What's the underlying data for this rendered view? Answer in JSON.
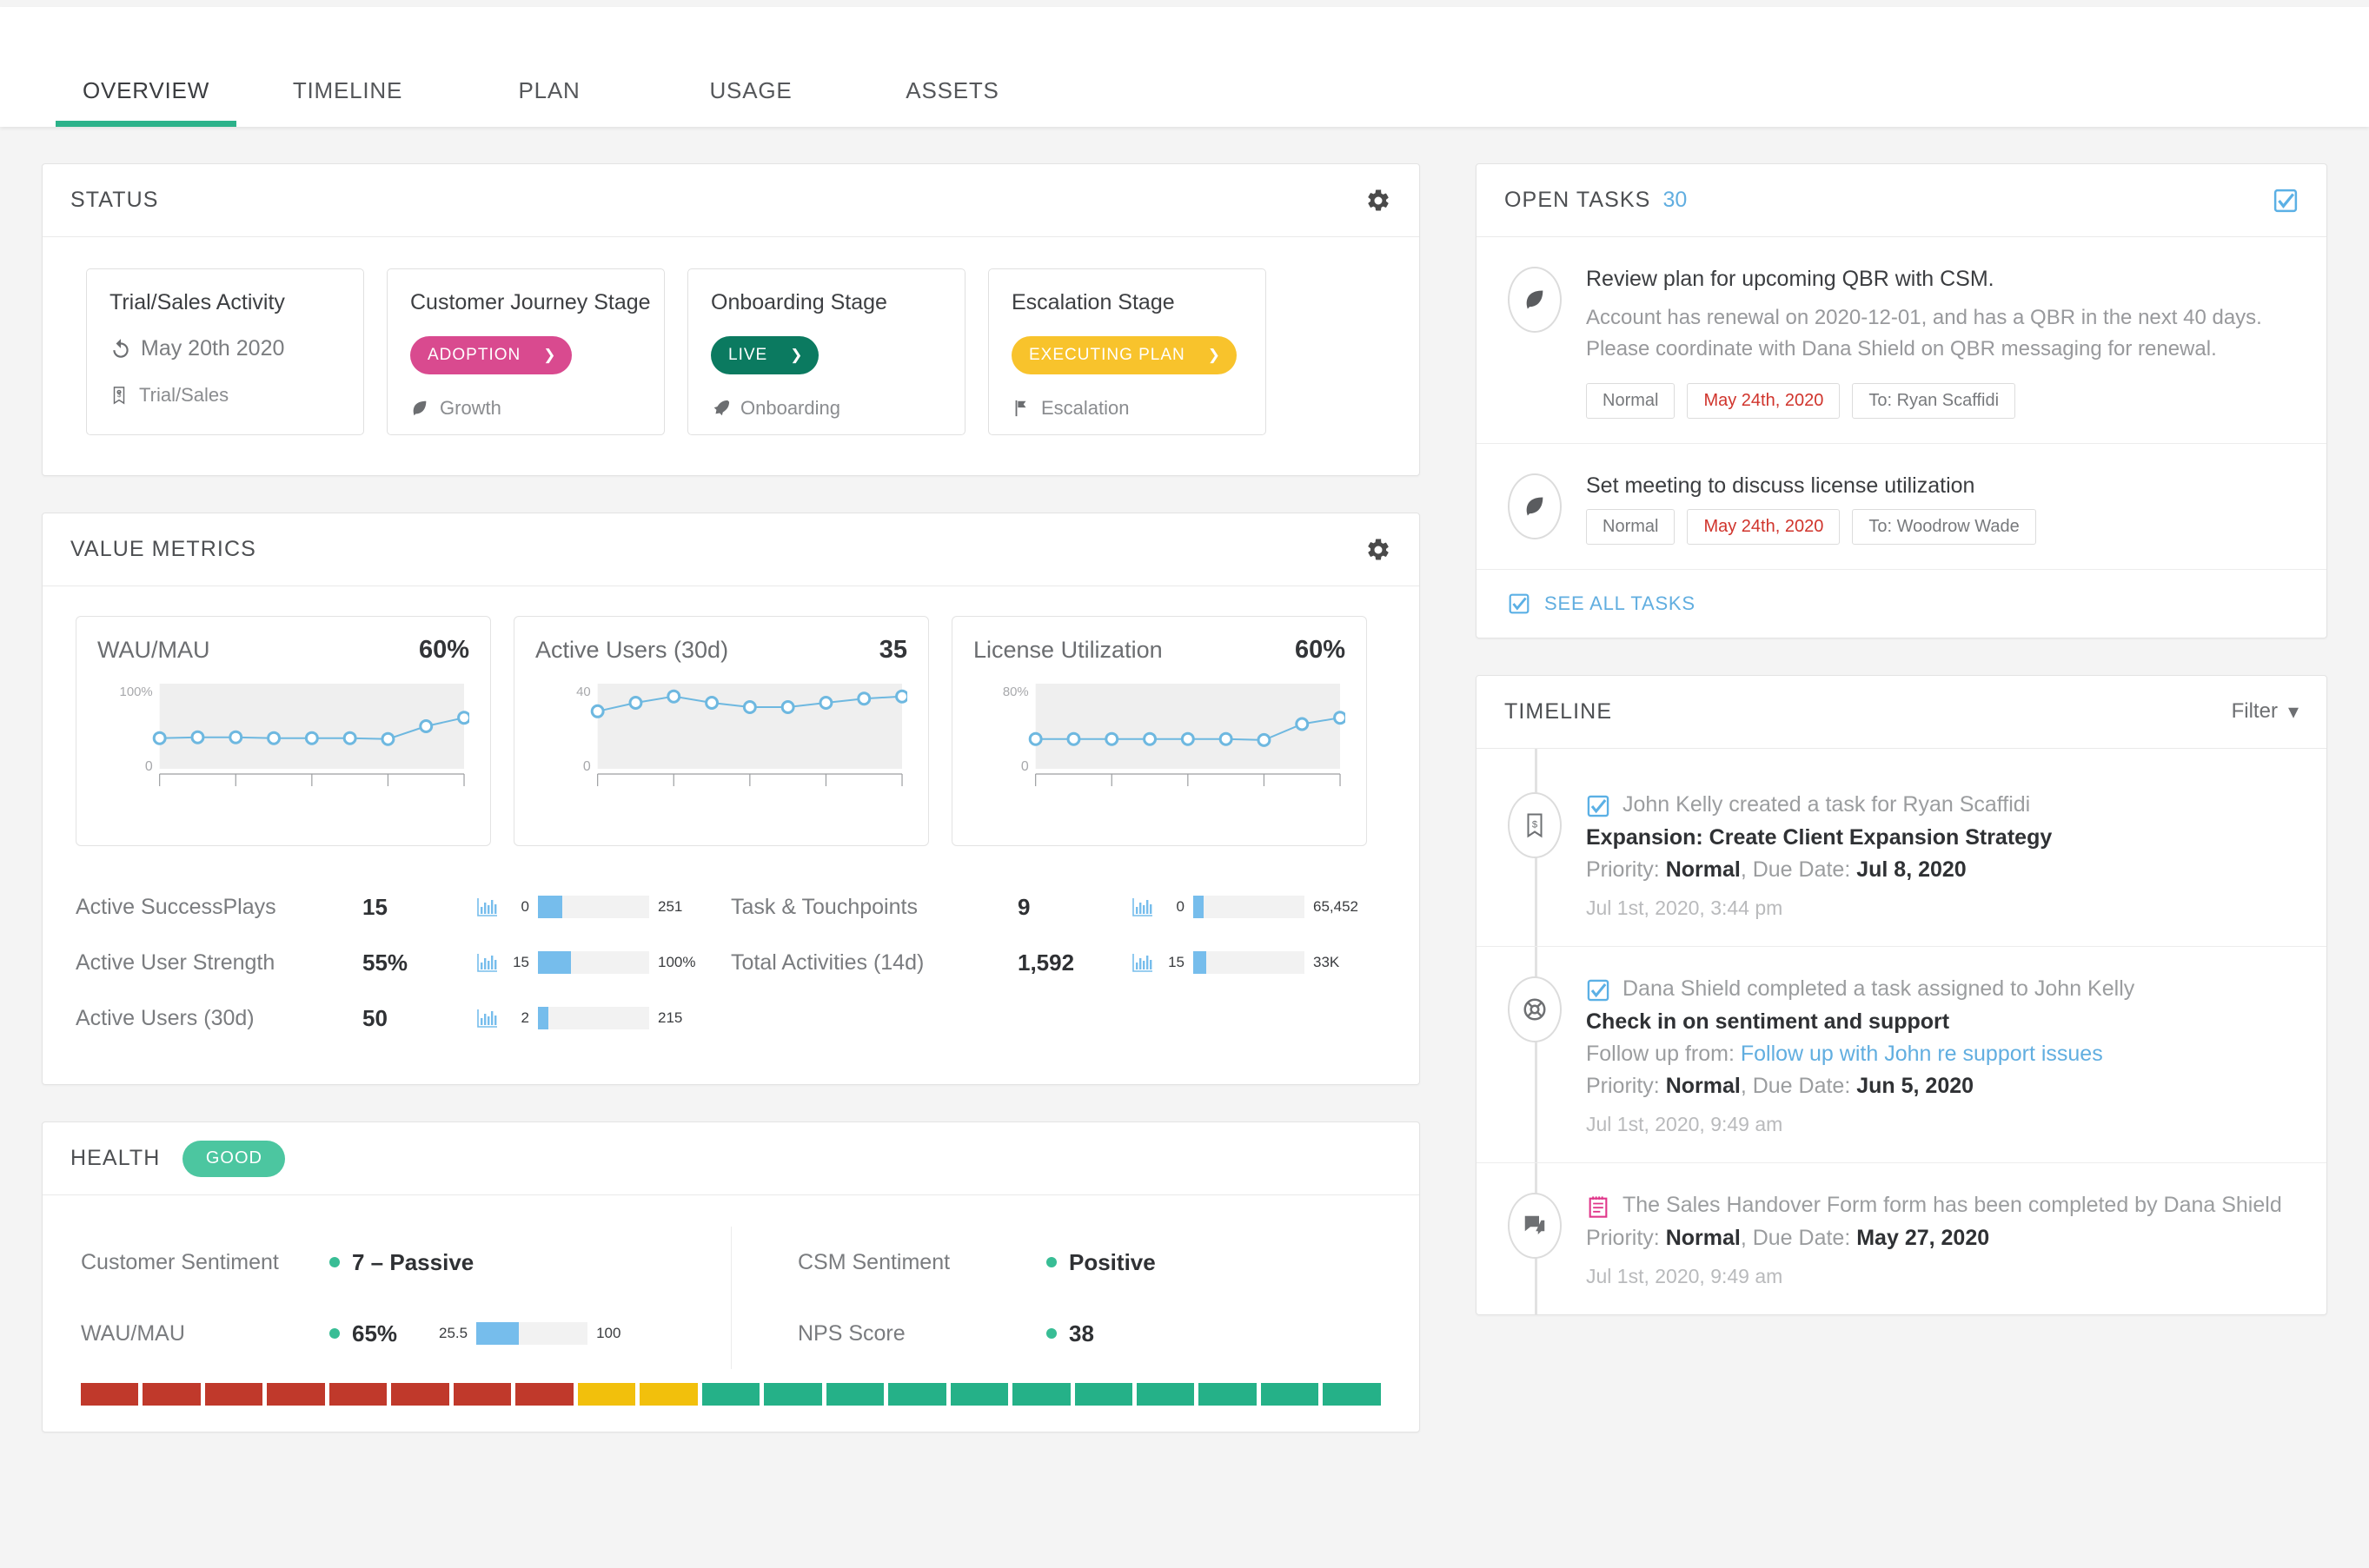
{
  "tabs": [
    {
      "label": "OVERVIEW",
      "active": true
    },
    {
      "label": "TIMELINE",
      "active": false
    },
    {
      "label": "PLAN",
      "active": false
    },
    {
      "label": "USAGE",
      "active": false
    },
    {
      "label": "ASSETS",
      "active": false
    }
  ],
  "accent": "#2cb28a",
  "status": {
    "title": "STATUS",
    "gear_icon": "gear-icon",
    "cards": [
      {
        "title": "Trial/Sales Activity",
        "value": "May 20th 2020",
        "value_icon": "history-icon",
        "foot": "Trial/Sales",
        "foot_icon": "price-tag-icon"
      },
      {
        "title": "Customer Journey Stage",
        "pill": "ADOPTION",
        "pill_color": "#d94a8f",
        "foot": "Growth",
        "foot_icon": "leaf-icon"
      },
      {
        "title": "Onboarding Stage",
        "pill": "LIVE",
        "pill_color": "#0b7a60",
        "foot": "Onboarding",
        "foot_icon": "rocket-icon"
      },
      {
        "title": "Escalation Stage",
        "pill": "EXECUTING PLAN",
        "pill_color": "#f8c32c",
        "foot": "Escalation",
        "foot_icon": "flag-icon"
      }
    ]
  },
  "value_metrics": {
    "title": "VALUE METRICS",
    "gear_icon": "gear-icon",
    "rows_left": [
      {
        "label": "Active SuccessPlays",
        "value": "15",
        "min": "0",
        "max": "251",
        "fill_pct": 22
      },
      {
        "label": "Active User Strength",
        "value": "55%",
        "min": "15",
        "max": "100%",
        "fill_pct": 30
      },
      {
        "label": "Active Users (30d)",
        "value": "50",
        "min": "2",
        "max": "215",
        "fill_pct": 9
      }
    ],
    "rows_right": [
      {
        "label": "Task & Touchpoints",
        "value": "9",
        "min": "0",
        "max": "65,452",
        "fill_pct": 9
      },
      {
        "label": "Total Activities (14d)",
        "value": "1,592",
        "min": "15",
        "max": "33K",
        "fill_pct": 12
      }
    ]
  },
  "chart_data": [
    {
      "type": "line",
      "title": "WAU/MAU",
      "display_value": "60%",
      "ylabel": "",
      "xlabel": "",
      "ytick_top": "100%",
      "ytick_bottom": "0",
      "ylim": [
        0,
        100
      ],
      "x": [
        1,
        2,
        3,
        4,
        5,
        6,
        7,
        8,
        9
      ],
      "values": [
        36,
        37,
        37,
        36,
        36,
        36,
        35,
        50,
        60
      ],
      "grid": false,
      "legend": "none",
      "point_color": "#6eb8e0",
      "plot_bg": "#efefef"
    },
    {
      "type": "line",
      "title": "Active Users (30d)",
      "display_value": "35",
      "ylabel": "",
      "xlabel": "",
      "ytick_top": "40",
      "ytick_bottom": "0",
      "ylim": [
        0,
        40
      ],
      "x": [
        1,
        2,
        3,
        4,
        5,
        6,
        7,
        8,
        9
      ],
      "values": [
        27,
        31,
        34,
        31,
        29,
        29,
        31,
        33,
        34
      ],
      "grid": false,
      "legend": "none",
      "point_color": "#6eb8e0",
      "plot_bg": "#efefef"
    },
    {
      "type": "line",
      "title": "License Utilization",
      "display_value": "60%",
      "ylabel": "",
      "xlabel": "",
      "ytick_top": "80%",
      "ytick_bottom": "0",
      "ylim": [
        0,
        80
      ],
      "x": [
        1,
        2,
        3,
        4,
        5,
        6,
        7,
        8,
        9
      ],
      "values": [
        28,
        28,
        28,
        28,
        28,
        28,
        27,
        42,
        48
      ],
      "grid": false,
      "legend": "none",
      "point_color": "#6eb8e0",
      "plot_bg": "#efefef"
    }
  ],
  "health": {
    "title": "HEALTH",
    "badge": "GOOD",
    "badge_color": "#4cc6a0",
    "left_rows": [
      {
        "label": "Customer Sentiment",
        "value": "7 – Passive"
      },
      {
        "label": "WAU/MAU",
        "value": "65%",
        "min": "25.5",
        "max": "100",
        "fill_pct": 38
      }
    ],
    "right_rows": [
      {
        "label": "CSM Sentiment",
        "value": "Positive"
      },
      {
        "label": "NPS Score",
        "value": "38"
      }
    ],
    "bar_segments": [
      "#c0392b",
      "#c0392b",
      "#c0392b",
      "#c0392b",
      "#c0392b",
      "#c0392b",
      "#c0392b",
      "#c0392b",
      "#f2c00c",
      "#f2c00c",
      "#25b188",
      "#25b188",
      "#25b188",
      "#25b188",
      "#25b188",
      "#25b188",
      "#25b188",
      "#25b188",
      "#25b188",
      "#25b188",
      "#25b188"
    ]
  },
  "open_tasks": {
    "title": "OPEN TASKS",
    "count": "30",
    "header_icon": "checkbox-icon",
    "see_all_label": "SEE ALL TASKS",
    "see_all_icon": "checkbox-icon",
    "items": [
      {
        "icon": "leaf-icon",
        "title": "Review plan for upcoming QBR with CSM.",
        "desc": "Account has renewal on 2020-12-01, and has a QBR in the next 40 days. Please coordinate with Dana Shield on QBR messaging for renewal.",
        "priority": "Normal",
        "due": "May 24th, 2020",
        "assignee": "To: Ryan Scaffidi"
      },
      {
        "icon": "leaf-icon",
        "title": "Set meeting to discuss license utilization",
        "desc": "",
        "priority": "Normal",
        "due": "May 24th, 2020",
        "assignee": "To: Woodrow Wade"
      }
    ]
  },
  "timeline": {
    "title": "TIMELINE",
    "filter_label": "Filter",
    "filter_icon": "chevron-down-icon",
    "items": [
      {
        "rail_icon": "price-tag-icon",
        "line_icon": "checkbox-icon",
        "line1": "John Kelly created a task for Ryan Scaffidi",
        "subject": "Expansion: Create Client Expansion Strategy",
        "followup_prefix": "",
        "followup_link": "",
        "meta_priority_prefix": "Priority: ",
        "meta_priority": "Normal",
        "meta_due_prefix": ", Due Date: ",
        "meta_due": "Jul 8, 2020",
        "time": "Jul 1st, 2020, 3:44 pm"
      },
      {
        "rail_icon": "lifebuoy-icon",
        "line_icon": "checkbox-icon",
        "line1": "Dana Shield completed a task assigned to John Kelly",
        "subject": "Check in on sentiment and support",
        "followup_prefix": "Follow up from: ",
        "followup_link": "Follow up with John re support issues",
        "meta_priority_prefix": "Priority: ",
        "meta_priority": "Normal",
        "meta_due_prefix": ", Due Date: ",
        "meta_due": "Jun 5, 2020",
        "time": "Jul 1st, 2020, 9:49 am"
      },
      {
        "rail_icon": "comment-icon",
        "line_icon": "form-icon",
        "line1": "The Sales Handover Form form has been completed by Dana Shield",
        "subject": "",
        "followup_prefix": "",
        "followup_link": "",
        "meta_priority_prefix": "Priority: ",
        "meta_priority": "Normal",
        "meta_due_prefix": ", Due Date: ",
        "meta_due": "May 27, 2020",
        "time": "Jul 1st, 2020, 9:49 am"
      }
    ]
  }
}
